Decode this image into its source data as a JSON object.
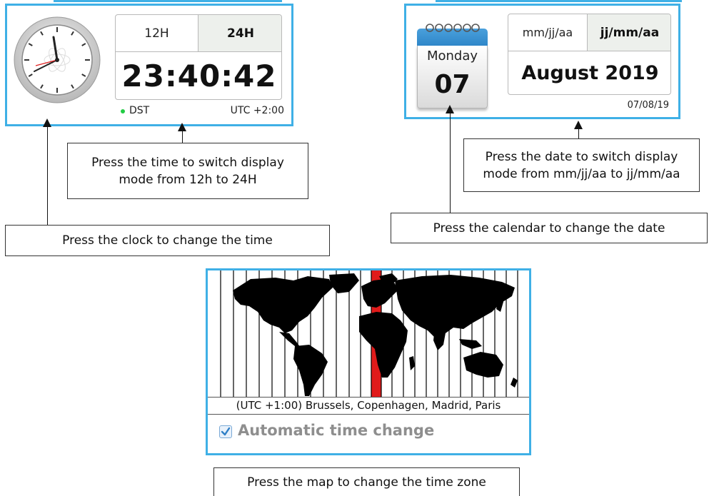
{
  "clock_widget": {
    "mode_12h_label": "12H",
    "mode_24h_label": "24H",
    "time_display": "23:40:42",
    "dst_label": "DST",
    "utc_offset_label": "UTC +2:00",
    "dst_indicator_color": "#22cc44"
  },
  "calendar_widget": {
    "weekday": "Monday",
    "day": "07",
    "format_mmjjaa_label": "mm/jj/aa",
    "format_jjmmaa_label": "jj/mm/aa",
    "month_year": "August 2019",
    "short_date": "07/08/19"
  },
  "map_widget": {
    "timezone_label": "(UTC +1:00) Brussels, Copenhagen, Madrid, Paris",
    "auto_time_change_label": "Automatic time change",
    "auto_time_change_checked": true,
    "selected_zone_color": "#e01b1b"
  },
  "callouts": {
    "time_switch": "Press the time to switch display\nmode from 12h to 24H",
    "clock_change": "Press the clock to change the time",
    "date_switch": "Press the date to switch display\nmode from mm/jj/aa to jj/mm/aa",
    "calendar_change": "Press the calendar to change the date",
    "map_change": "Press the map to change the time zone"
  },
  "colors": {
    "accent_border": "#3fb0e6",
    "selected_segment_bg": "#edf0ec",
    "calendar_header": "#2e86c8"
  }
}
